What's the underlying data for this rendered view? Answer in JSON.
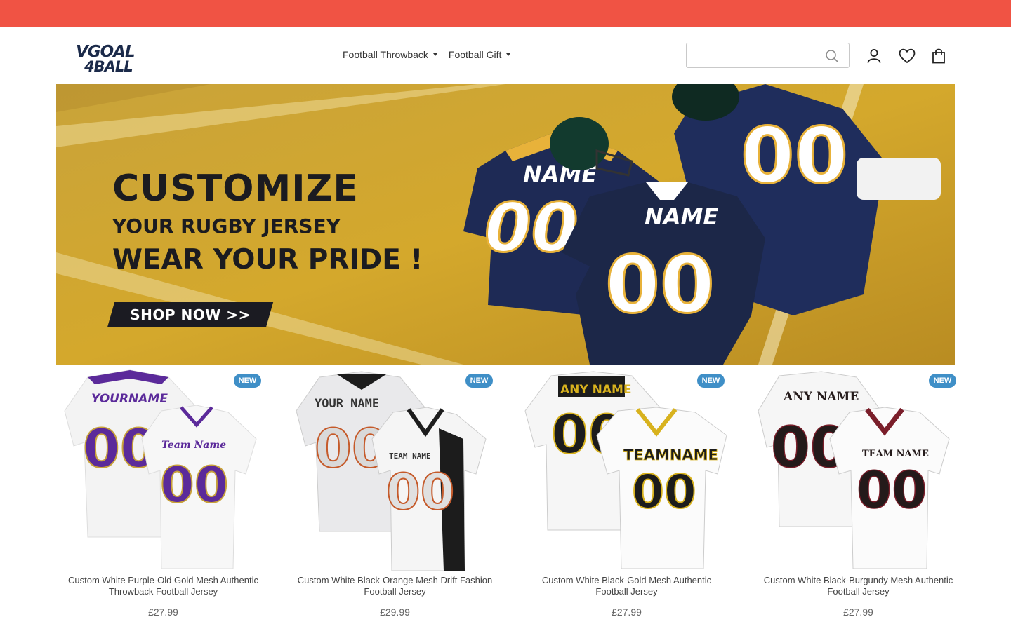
{
  "colors": {
    "topbar": "#f05344",
    "accent_navy": "#1b2a4a",
    "badge": "#3f8fc7",
    "turf": "#c89a2a"
  },
  "header": {
    "logo_alt": "VGOAL 4BALL",
    "nav": [
      {
        "label": "Football Throwback"
      },
      {
        "label": "Football Gift"
      }
    ],
    "search": {
      "placeholder": "",
      "value": ""
    },
    "icons": [
      "search-icon",
      "account-icon",
      "wishlist-icon",
      "cart-icon"
    ]
  },
  "hero": {
    "line1": "CUSTOMIZE",
    "line2": "YOUR RUGBY JERSEY",
    "line3": "WEAR YOUR PRIDE !",
    "cta": "SHOP NOW >>",
    "jersey_name": "NAME",
    "jersey_number": "00"
  },
  "products": [
    {
      "badge": "NEW",
      "title": "Custom White Purple-Old Gold Mesh Authentic Throwback Football Jersey",
      "price": "£27.99",
      "print_name": "YOURNAME",
      "team": "Team Name",
      "number": "00",
      "accent": "#5b2a9a",
      "trim": "#c8a13a"
    },
    {
      "badge": "NEW",
      "title": "Custom White Black-Orange Mesh Drift Fashion Football Jersey",
      "price": "£29.99",
      "print_name": "YOUR NAME",
      "team": "TEAM NAME",
      "number": "00",
      "accent": "#1c1c1c",
      "trim": "#c55a2a"
    },
    {
      "badge": "NEW",
      "title": "Custom White Black-Gold Mesh Authentic Football Jersey",
      "price": "£27.99",
      "print_name": "ANY NAME",
      "team": "TEAMNAME",
      "number": "00",
      "accent": "#1c1c1c",
      "trim": "#d8b21e"
    },
    {
      "badge": "NEW",
      "title": "Custom White Black-Burgundy Mesh Authentic Football Jersey",
      "price": "£27.99",
      "print_name": "ANY NAME",
      "team": "TEAM NAME",
      "number": "00",
      "accent": "#241a1a",
      "trim": "#7a1e2a"
    }
  ]
}
